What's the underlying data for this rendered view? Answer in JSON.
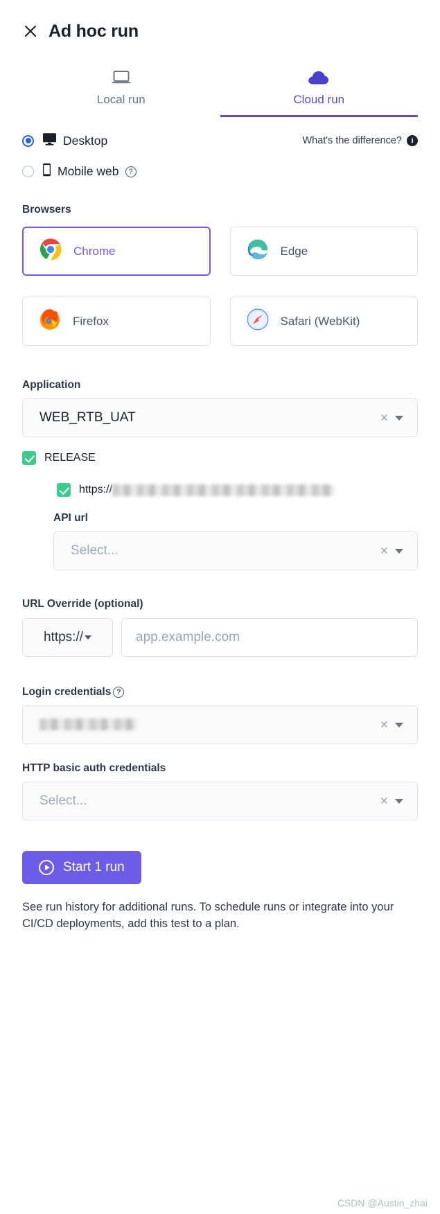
{
  "header": {
    "title": "Ad hoc run",
    "close_icon": "close-icon"
  },
  "tabs": [
    {
      "label": "Local run",
      "icon": "laptop-icon",
      "active": false
    },
    {
      "label": "Cloud run",
      "icon": "cloud-icon",
      "active": true
    }
  ],
  "run_target": {
    "options": [
      {
        "label": "Desktop",
        "icon": "monitor-icon",
        "selected": true
      },
      {
        "label": "Mobile web",
        "icon": "phone-icon",
        "selected": false,
        "help_icon": "question-mark-icon"
      }
    ],
    "difference_link": {
      "label": "What's the difference?",
      "icon": "info-icon"
    }
  },
  "browsers": {
    "label": "Browsers",
    "items": [
      {
        "name": "Chrome",
        "icon": "chrome-icon",
        "selected": true
      },
      {
        "name": "Edge",
        "icon": "edge-icon",
        "selected": false
      },
      {
        "name": "Firefox",
        "icon": "firefox-icon",
        "selected": false
      },
      {
        "name": "Safari (WebKit)",
        "icon": "safari-icon",
        "selected": false
      }
    ]
  },
  "application": {
    "label": "Application",
    "selected_value": "WEB_RTB_UAT",
    "clear_glyph": "×",
    "release": {
      "label": "RELEASE",
      "checked": true,
      "url": {
        "prefix": "https://",
        "redacted": true,
        "checked": true
      }
    },
    "api_url": {
      "label": "API url",
      "placeholder": "Select...",
      "value": "",
      "clear_glyph": "×"
    }
  },
  "url_override": {
    "label": "URL Override (optional)",
    "protocol": "https://",
    "placeholder": "app.example.com",
    "value": ""
  },
  "login_credentials": {
    "label": "Login credentials",
    "help_icon": "question-mark-icon",
    "value_redacted": true,
    "value": "",
    "clear_glyph": "×"
  },
  "http_basic_auth": {
    "label": "HTTP basic auth credentials",
    "placeholder": "Select...",
    "value": "",
    "clear_glyph": "×"
  },
  "footer": {
    "start_button": "Start 1 run",
    "note": "See run history for additional runs. To schedule runs or integrate into your CI/CD deployments, add this test to a plan.",
    "watermark": "CSDN @Austin_zhai"
  },
  "colors": {
    "accent_purple": "#6c5ce7",
    "tab_active": "#5b4ad1",
    "radio_blue": "#2563eb",
    "checkbox_green": "#3ccb8c",
    "border": "#dfe3e8",
    "text": "#1a202c",
    "muted": "#6b7280"
  }
}
